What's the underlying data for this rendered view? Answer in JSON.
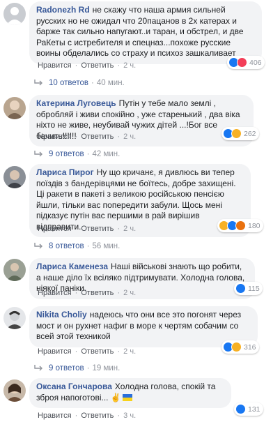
{
  "comments": [
    {
      "author": "Radonezh Rd",
      "text": "не скажу что наша армия сильней русских но не ожидал что 20пацанов в 2х катерах и барже так сильно напугают..и таран, и обстрел, и две РаКеты с истребителя и спецназ...похоже русские воины обделались со страху и психоз зашкаливает",
      "like": "Нравится",
      "reply": "Ответить",
      "time": "2 ч.",
      "reactions": "406",
      "replies_label": "10 ответов",
      "replies_time": "40 мин."
    },
    {
      "author": "Катерина Луговець",
      "text": "Путін у тебе мало землі , обробляй і живи спокійно , уже старенький , два віка ніхто не живе, неубивай чужих дітей ...!Бог все бачить!!!!!!",
      "like": "Нравится",
      "reply": "Ответить",
      "time": "2 ч.",
      "reactions": "262",
      "replies_label": "9 ответов",
      "replies_time": "42 мин."
    },
    {
      "author": "Лариса Пирог",
      "text": "Ну що кричанє, я дивлюсь ви тепер поїздів з бандерівцями не боїтесь, добре захищені. Ці ракети в пакеті з великою російською пенсією йшли, тільки вас попередити забули. Щось мені підказує путін вас першими в рай вирішив відправити.",
      "like": "Нравится",
      "reply": "Ответить",
      "time": "2 ч.",
      "reactions": "180",
      "replies_label": "8 ответов",
      "replies_time": "56 мин."
    },
    {
      "author": "Лариса Каменеза",
      "text": "Наші військові знають що робити, а наше діло їх всіляко підтримувати. Холодна голова, ніякої паніки.",
      "like": "Нравится",
      "reply": "Ответить",
      "time": "2 ч.",
      "reactions": "115"
    },
    {
      "author": "Nikita Choliy",
      "text": "надеюсь что они все это погонят через мост и он рухнет нафиг в море к чертям собачим со всей этой техникой",
      "like": "Нравится",
      "reply": "Ответить",
      "time": "2 ч.",
      "reactions": "316",
      "replies_label": "9 ответов",
      "replies_time": "19 мин."
    },
    {
      "author": "Оксана Гончарова",
      "text": "Холодна голова, спокій та зброя напоготові...",
      "like": "Нравится",
      "reply": "Ответить",
      "time": "3 ч.",
      "reactions": "131"
    }
  ],
  "colors": {
    "bubble": "#f2f3f5",
    "author": "#385898",
    "meta": "#90949c",
    "like": "#1877f2",
    "haha": "#f7b125",
    "angry": "#e9710f",
    "love": "#f33e58"
  }
}
